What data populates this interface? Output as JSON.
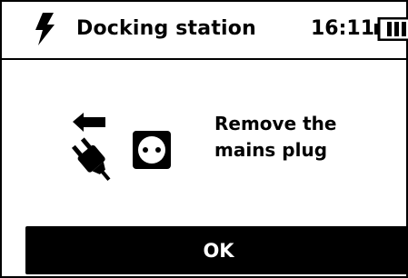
{
  "header": {
    "icon": "lightning-bolt-icon",
    "title": "Docking station",
    "time": "16:11",
    "battery_icon": "battery-icon"
  },
  "message": {
    "line1": "Remove the",
    "line2": "mains plug",
    "icons": [
      "arrow-left-icon",
      "plug-icon",
      "socket-icon"
    ]
  },
  "actions": {
    "ok_label": "OK"
  }
}
